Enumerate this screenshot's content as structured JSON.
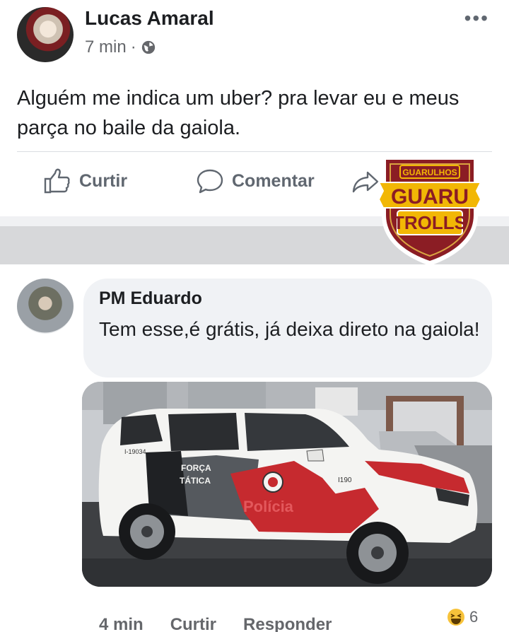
{
  "post": {
    "author": "Lucas Amaral",
    "time": "7 min",
    "separator": "·",
    "privacy_icon": "globe-icon",
    "more_icon": "•••",
    "text": "Alguém me indica um uber? pra  levar eu e meus parça no baile da gaiola.",
    "actions": {
      "like": "Curtir",
      "comment": "Comentar",
      "share": "Compartilhar"
    }
  },
  "watermark": {
    "top": "GUARULHOS",
    "middle": "GUARU",
    "bottom": "TROLLS",
    "colors": {
      "shield": "#8b1d24",
      "banner": "#f2b705",
      "outline": "#ffffff"
    }
  },
  "comment": {
    "author": "PM Eduardo",
    "text": "Tem esse,é grátis, já deixa direto na gaiola!",
    "photo": {
      "car_texts": {
        "force": "FORÇA",
        "tactical": "TÁTICA",
        "brand": "Polícia",
        "number": "I-19034",
        "side_number": "I190"
      }
    },
    "footer": {
      "time": "4 min",
      "like": "Curtir",
      "reply": "Responder"
    },
    "reaction_count": "6"
  },
  "colors": {
    "secondary_text": "#65676b",
    "bubble": "#f0f2f5",
    "separator_band": "#d7d8da"
  }
}
